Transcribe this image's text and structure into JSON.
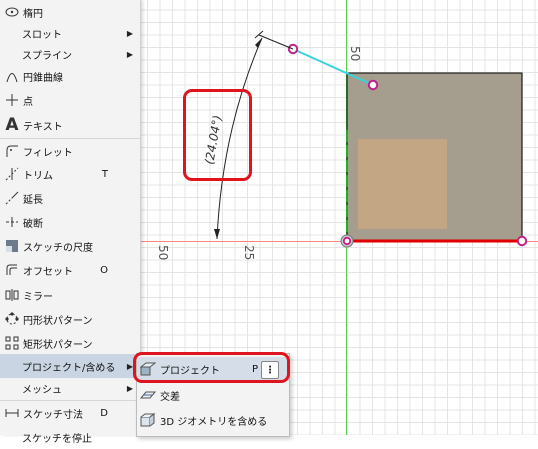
{
  "menu": {
    "items": [
      {
        "icon": "ellipse-icon",
        "label": "楕円",
        "shortcut": "",
        "submenu": false
      },
      {
        "icon": "",
        "label": "スロット",
        "shortcut": "",
        "submenu": true
      },
      {
        "icon": "",
        "label": "スプライン",
        "shortcut": "",
        "submenu": true
      },
      {
        "icon": "conic-curve-icon",
        "label": "円錐曲線",
        "shortcut": "",
        "submenu": false
      },
      {
        "icon": "point-icon",
        "label": "点",
        "shortcut": "",
        "submenu": false
      },
      {
        "icon": "text-icon",
        "label": "テキスト",
        "shortcut": "",
        "submenu": false
      },
      {
        "icon": "fillet-icon",
        "label": "フィレット",
        "shortcut": "",
        "submenu": false
      },
      {
        "icon": "trim-icon",
        "label": "トリム",
        "shortcut": "T",
        "submenu": false
      },
      {
        "icon": "extend-icon",
        "label": "延長",
        "shortcut": "",
        "submenu": false
      },
      {
        "icon": "break-icon",
        "label": "破断",
        "shortcut": "",
        "submenu": false
      },
      {
        "icon": "sketch-scale-icon",
        "label": "スケッチの尺度",
        "shortcut": "",
        "submenu": false
      },
      {
        "icon": "offset-icon",
        "label": "オフセット",
        "shortcut": "O",
        "submenu": false
      },
      {
        "icon": "mirror-icon",
        "label": "ミラー",
        "shortcut": "",
        "submenu": false
      },
      {
        "icon": "circular-pattern-icon",
        "label": "円形状パターン",
        "shortcut": "",
        "submenu": false
      },
      {
        "icon": "rectangular-pattern-icon",
        "label": "矩形状パターン",
        "shortcut": "",
        "submenu": false
      },
      {
        "icon": "",
        "label": "プロジェクト/含める",
        "shortcut": "",
        "submenu": true
      },
      {
        "icon": "",
        "label": "メッシュ",
        "shortcut": "",
        "submenu": true
      },
      {
        "icon": "sketch-dimension-icon",
        "label": "スケッチ寸法",
        "shortcut": "D",
        "submenu": false
      },
      {
        "icon": "",
        "label": "スケッチを停止",
        "shortcut": "",
        "submenu": false
      }
    ]
  },
  "submenu": {
    "items": [
      {
        "icon": "project-icon",
        "label": "プロジェクト",
        "shortcut": "P"
      },
      {
        "icon": "intersect-icon",
        "label": "交差",
        "shortcut": ""
      },
      {
        "icon": "include-3d-geometry-icon",
        "label": "3D ジオメトリを含める",
        "shortcut": ""
      }
    ],
    "more_label": "⋮"
  },
  "canvas": {
    "angle_dimension": "(24.04°)",
    "axis_labels": [
      "50",
      "25",
      "50"
    ]
  },
  "colors": {
    "highlight_red": "#e0141e",
    "face": "#a59d8d",
    "inner_face": "#c8a984",
    "construction_line": "#3ad2dc",
    "point": "#c0208c"
  }
}
